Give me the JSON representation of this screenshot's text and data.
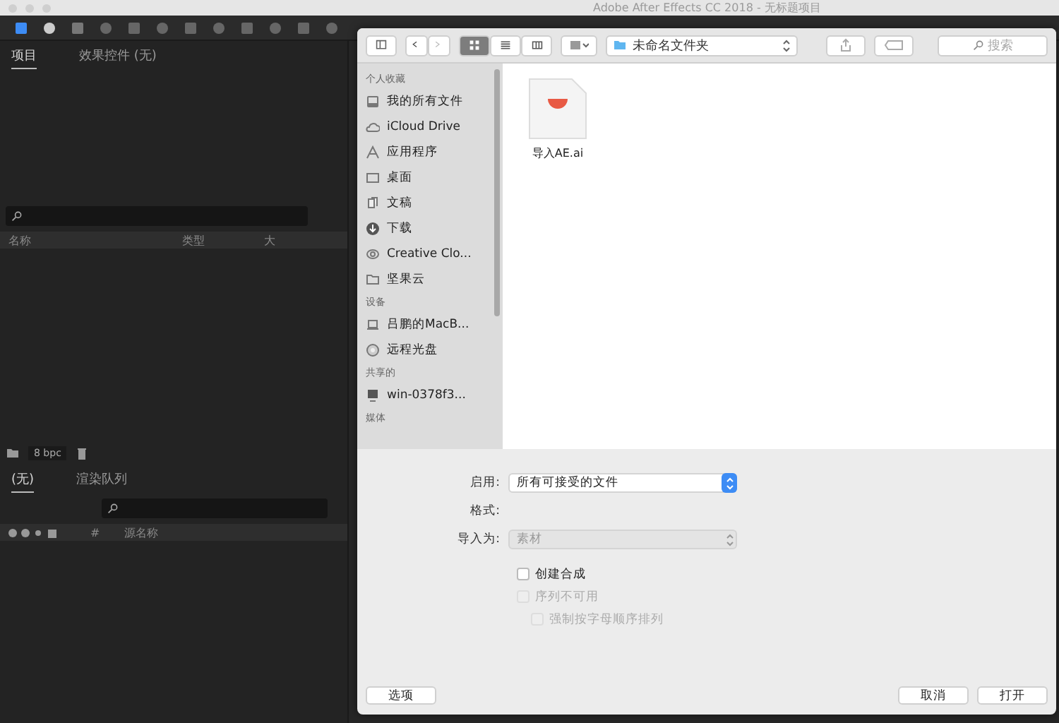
{
  "window": {
    "title": "Adobe After Effects CC 2018 - 无标题项目"
  },
  "project_panel": {
    "tabs": [
      {
        "label": "项目",
        "selected": true
      },
      {
        "label": "效果控件 (无)",
        "selected": false
      }
    ],
    "columns": [
      "名称",
      "类型",
      "大"
    ],
    "bit_depth": "8 bpc"
  },
  "timeline_panel": {
    "tabs": [
      {
        "label": "(无)",
        "selected": true
      },
      {
        "label": "渲染队列",
        "selected": false
      }
    ],
    "columns": [
      "#",
      "源名称"
    ]
  },
  "dialog": {
    "view_modes": [
      {
        "kind": "icons",
        "selected": true
      },
      {
        "kind": "list",
        "selected": false
      },
      {
        "kind": "columns",
        "selected": false
      }
    ],
    "location": "未命名文件夹",
    "search": {
      "placeholder": "搜索"
    },
    "sidebar": [
      {
        "title": "个人收藏",
        "items": [
          {
            "label": "我的所有文件",
            "kind": "files"
          },
          {
            "label": "iCloud Drive",
            "kind": "cloud"
          },
          {
            "label": "应用程序",
            "kind": "apps"
          },
          {
            "label": "桌面",
            "kind": "desktop"
          },
          {
            "label": "文稿",
            "kind": "docs"
          },
          {
            "label": "下载",
            "kind": "download"
          },
          {
            "label": "Creative Clo...",
            "kind": "cc"
          },
          {
            "label": "坚果云",
            "kind": "folder"
          }
        ]
      },
      {
        "title": "设备",
        "items": [
          {
            "label": "吕鹏的MacB...",
            "kind": "laptop"
          },
          {
            "label": "远程光盘",
            "kind": "disc"
          }
        ]
      },
      {
        "title": "共享的",
        "items": [
          {
            "label": "win-0378f3...",
            "kind": "monitor"
          }
        ]
      },
      {
        "title": "媒体"
      }
    ],
    "files": [
      {
        "name": "导入AE.ai"
      }
    ],
    "fields": [
      {
        "kind": "select",
        "label": "启用:",
        "value": "所有可接受的文件",
        "disabled": false
      },
      {
        "kind": "empty",
        "label": "格式:"
      },
      {
        "kind": "select",
        "label": "导入为:",
        "value": "素材",
        "disabled": true
      }
    ],
    "checkboxes": [
      {
        "label": "创建合成",
        "checked": false,
        "disabled": false
      },
      {
        "label": "序列不可用",
        "checked": false,
        "disabled": true,
        "children": [
          {
            "label": "强制按字母顺序排列",
            "checked": false,
            "disabled": true
          }
        ]
      }
    ],
    "buttons": {
      "options": "选项",
      "cancel": "取消",
      "open": "打开"
    }
  }
}
